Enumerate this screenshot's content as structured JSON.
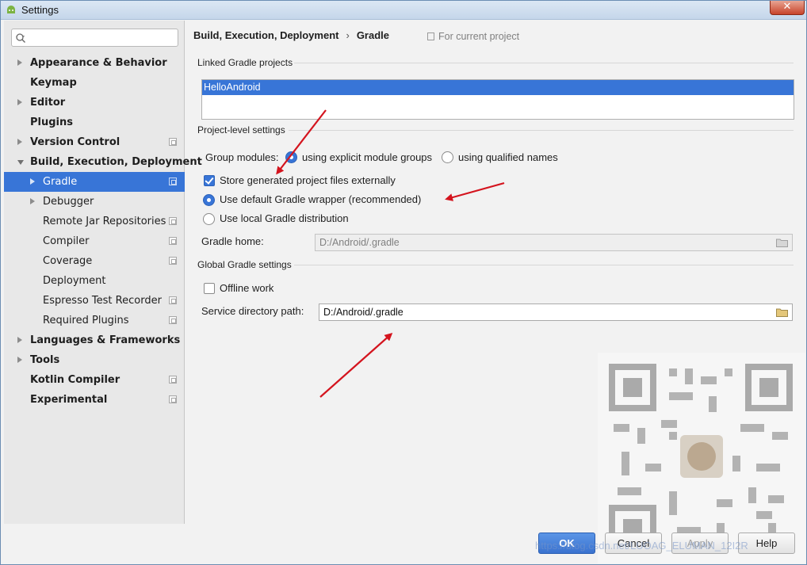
{
  "window": {
    "title": "Settings",
    "close_label": "✕"
  },
  "sidebar": {
    "search": {
      "value": "",
      "placeholder": ""
    },
    "items": [
      {
        "label": "Appearance & Behavior",
        "bold": true,
        "arrow": "right",
        "indent": 0,
        "project_icon": false
      },
      {
        "label": "Keymap",
        "bold": true,
        "arrow": "none",
        "indent": 0,
        "project_icon": false
      },
      {
        "label": "Editor",
        "bold": true,
        "arrow": "right",
        "indent": 0,
        "project_icon": false
      },
      {
        "label": "Plugins",
        "bold": true,
        "arrow": "none",
        "indent": 0,
        "project_icon": false
      },
      {
        "label": "Version Control",
        "bold": true,
        "arrow": "right",
        "indent": 0,
        "project_icon": true
      },
      {
        "label": "Build, Execution, Deployment",
        "bold": true,
        "arrow": "down",
        "indent": 0,
        "project_icon": false
      },
      {
        "label": "Gradle",
        "bold": false,
        "arrow": "right",
        "indent": 1,
        "project_icon": true,
        "selected": true
      },
      {
        "label": "Debugger",
        "bold": false,
        "arrow": "right",
        "indent": 1,
        "project_icon": false
      },
      {
        "label": "Remote Jar Repositories",
        "bold": false,
        "arrow": "none",
        "indent": 1,
        "project_icon": true
      },
      {
        "label": "Compiler",
        "bold": false,
        "arrow": "none",
        "indent": 1,
        "project_icon": true
      },
      {
        "label": "Coverage",
        "bold": false,
        "arrow": "none",
        "indent": 1,
        "project_icon": true
      },
      {
        "label": "Deployment",
        "bold": false,
        "arrow": "none",
        "indent": 1,
        "project_icon": false
      },
      {
        "label": "Espresso Test Recorder",
        "bold": false,
        "arrow": "none",
        "indent": 1,
        "project_icon": true
      },
      {
        "label": "Required Plugins",
        "bold": false,
        "arrow": "none",
        "indent": 1,
        "project_icon": true
      },
      {
        "label": "Languages & Frameworks",
        "bold": true,
        "arrow": "right",
        "indent": 0,
        "project_icon": false
      },
      {
        "label": "Tools",
        "bold": true,
        "arrow": "right",
        "indent": 0,
        "project_icon": false
      },
      {
        "label": "Kotlin Compiler",
        "bold": true,
        "arrow": "none",
        "indent": 0,
        "project_icon": true
      },
      {
        "label": "Experimental",
        "bold": true,
        "arrow": "none",
        "indent": 0,
        "project_icon": true
      }
    ]
  },
  "content": {
    "breadcrumb": {
      "parent": "Build, Execution, Deployment",
      "separator": "›",
      "current": "Gradle"
    },
    "for_project": "For current project",
    "linked_section": "Linked Gradle projects",
    "linked_projects": [
      "HelloAndroid"
    ],
    "project_section": "Project-level settings",
    "group_modules_label": "Group modules:",
    "group_options": [
      {
        "label": "using explicit module groups",
        "selected": true
      },
      {
        "label": "using qualified names",
        "selected": false
      }
    ],
    "store_external": {
      "label": "Store generated project files externally",
      "checked": true
    },
    "gradle_dist_options": [
      {
        "label": "Use default Gradle wrapper (recommended)",
        "selected": true
      },
      {
        "label": "Use local Gradle distribution",
        "selected": false
      }
    ],
    "gradle_home": {
      "label": "Gradle home:",
      "value": "D:/Android/.gradle"
    },
    "global_section": "Global Gradle settings",
    "offline_work": {
      "label": "Offline work",
      "checked": false
    },
    "service_dir": {
      "label": "Service directory path:",
      "value": "D:/Android/.gradle"
    }
  },
  "footer": {
    "ok": "OK",
    "cancel": "Cancel",
    "apply": "Apply",
    "help": "Help"
  },
  "watermark": "https://blog.csdn.net/LUOAG_ELUMAN_12I2R"
}
